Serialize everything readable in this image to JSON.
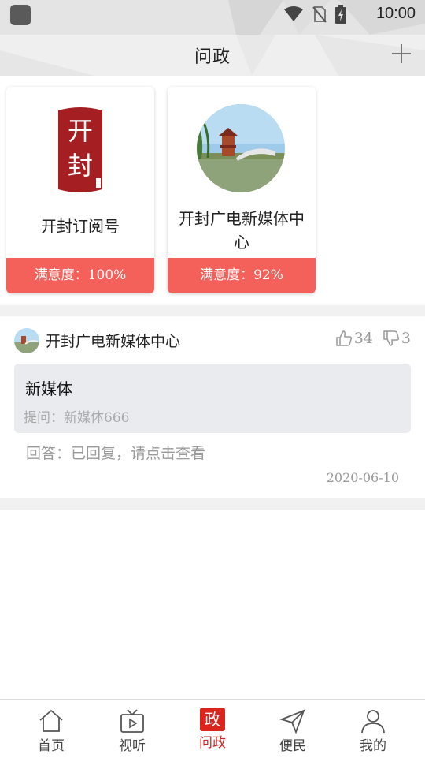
{
  "status_bar": {
    "time": "10:00"
  },
  "header": {
    "title": "问政"
  },
  "accounts": [
    {
      "name": "开封订阅号",
      "satisfaction": "满意度：100%",
      "logo_text": "开封"
    },
    {
      "name": "开封广电新媒体中心",
      "satisfaction": "满意度：92%"
    }
  ],
  "post": {
    "author": "开封广电新媒体中心",
    "likes": "34",
    "dislikes": "3",
    "question_title": "新媒体",
    "question_line": "提问：新媒体666",
    "answer_line": "回答：已回复，请点击查看",
    "date": "2020-06-10"
  },
  "tabs": [
    {
      "label": "首页",
      "icon": "home-icon"
    },
    {
      "label": "视听",
      "icon": "tv-icon"
    },
    {
      "label": "问政",
      "icon": "zheng-badge-icon",
      "badge": "政",
      "active": true
    },
    {
      "label": "便民",
      "icon": "send-icon"
    },
    {
      "label": "我的",
      "icon": "user-icon"
    }
  ],
  "colors": {
    "accent": "#f4605a",
    "active_tab": "#d32323",
    "logo_red": "#a51e22"
  }
}
